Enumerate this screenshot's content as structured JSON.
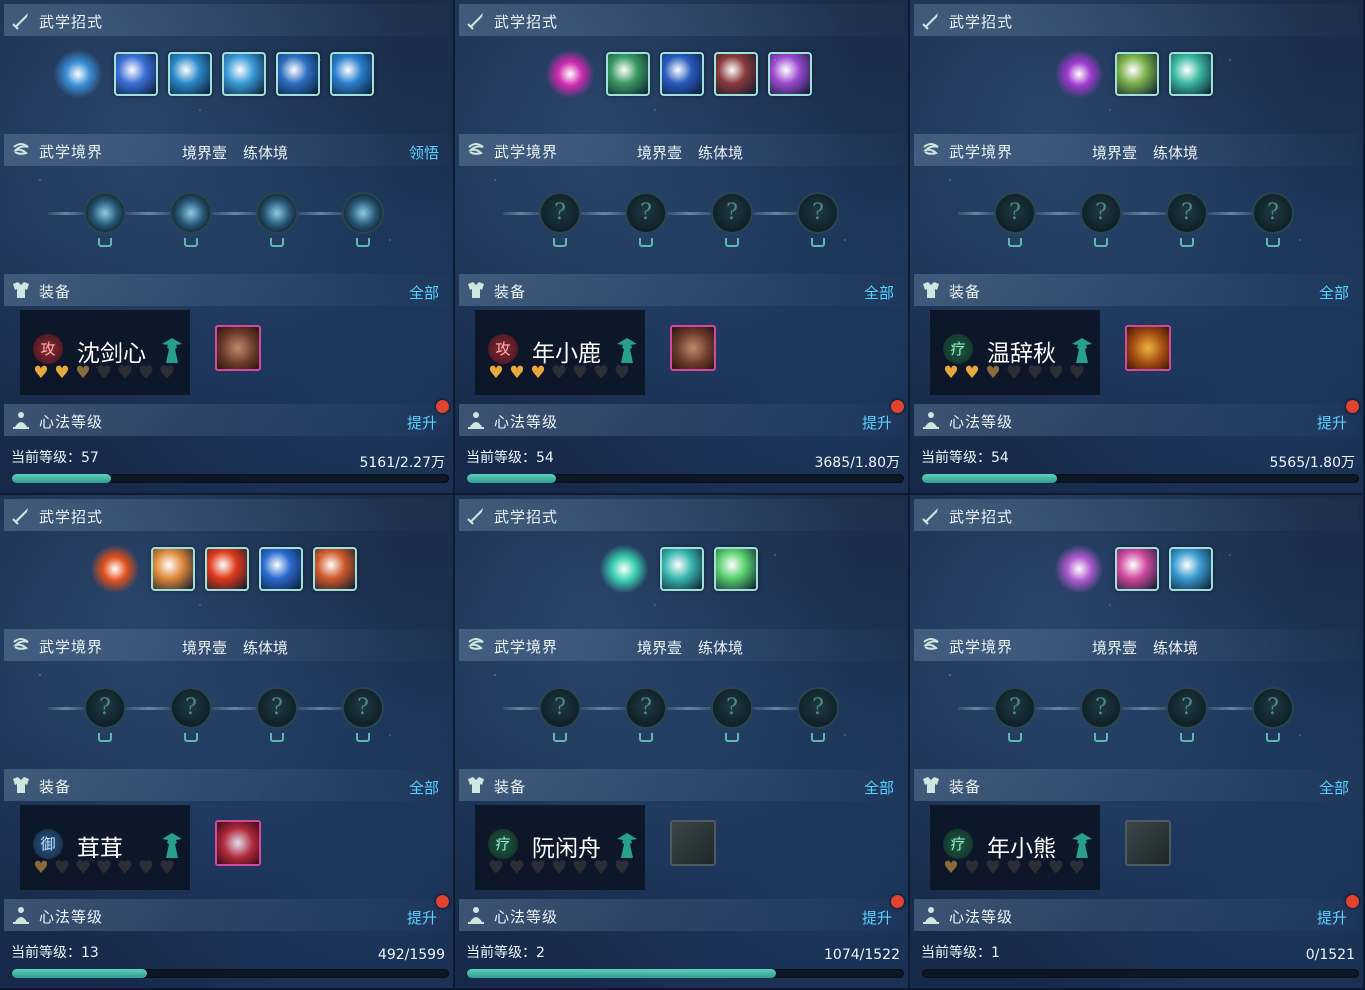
{
  "labels": {
    "skills_title": "武学招式",
    "realm_title": "武学境界",
    "realm_stage": "境界壹",
    "realm_name": "练体境",
    "equip_title": "装备",
    "equip_all": "全部",
    "heart_title": "心法等级",
    "upgrade": "提升",
    "current_level_prefix": "当前等级："
  },
  "colors": {
    "accent": "#5ad2ff",
    "progress": "#3fb5a5",
    "red_dot": "#e0432e",
    "heart_gold": "#e6a93a"
  },
  "panels": [
    {
      "realm_action": "领悟",
      "hero_name": "沈剑心",
      "role_badge": "攻",
      "role": "atk",
      "hearts": {
        "full": 2,
        "half": 1,
        "empty": 4
      },
      "level_text": "当前等级：57",
      "exp_text": "5161/2.27万",
      "exp_fraction": 0.227,
      "skill_colors": [
        "#3a8fd6",
        "#3b6fd8",
        "#2a88c8",
        "#3a9ad8",
        "#2a6fc0",
        "#2a7fd0"
      ],
      "gear": "pink",
      "realm_unlocked": true
    },
    {
      "realm_action": "",
      "hero_name": "年小鹿",
      "role_badge": "攻",
      "role": "atk",
      "hearts": {
        "full": 3,
        "half": 0,
        "empty": 4
      },
      "level_text": "当前等级：54",
      "exp_text": "3685/1.80万",
      "exp_fraction": 0.204,
      "skill_colors": [
        "#d02ab0",
        "#3a9a60",
        "#2a5ac0",
        "#8a3a3a",
        "#9a4ad0"
      ],
      "gear": "pink",
      "realm_unlocked": false
    },
    {
      "realm_action": "",
      "hero_name": "温辞秋",
      "role_badge": "疗",
      "role": "heal",
      "hearts": {
        "full": 2,
        "half": 1,
        "empty": 4
      },
      "level_text": "当前等级：54",
      "exp_text": "5565/1.80万",
      "exp_fraction": 0.309,
      "skill_colors": [
        "#a03ad0",
        "#7ab04a",
        "#3ab8a0"
      ],
      "gear": "gold",
      "realm_unlocked": false
    },
    {
      "realm_action": "",
      "hero_name": "茸茸",
      "role_badge": "御",
      "role": "def",
      "hearts": {
        "full": 0,
        "half": 1,
        "empty": 6
      },
      "level_text": "当前等级：13",
      "exp_text": "492/1599",
      "exp_fraction": 0.308,
      "skill_colors": [
        "#e0501a",
        "#e08a3a",
        "#e03a1a",
        "#2a6ad0",
        "#d05a2a"
      ],
      "gear": "red",
      "realm_unlocked": false
    },
    {
      "realm_action": "",
      "hero_name": "阮闲舟",
      "role_badge": "疗",
      "role": "heal",
      "hearts": {
        "full": 0,
        "half": 0,
        "empty": 7
      },
      "level_text": "当前等级：2",
      "exp_text": "1074/1522",
      "exp_fraction": 0.706,
      "skill_colors": [
        "#3ad0b0",
        "#3ab8b0",
        "#5ad070"
      ],
      "gear": "gray",
      "realm_unlocked": false
    },
    {
      "realm_action": "",
      "hero_name": "年小熊",
      "role_badge": "疗",
      "role": "heal",
      "hearts": {
        "full": 0,
        "half": 1,
        "empty": 6
      },
      "level_text": "当前等级：1",
      "exp_text": "0/1521",
      "exp_fraction": 0.0,
      "skill_colors": [
        "#b05ad0",
        "#d04aa0",
        "#3a9ad0"
      ],
      "gear": "gray",
      "realm_unlocked": false
    }
  ]
}
